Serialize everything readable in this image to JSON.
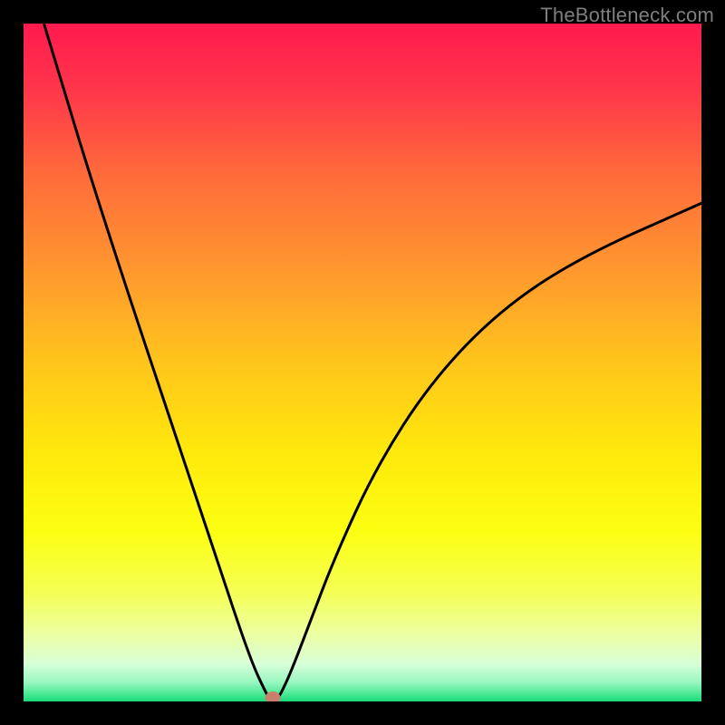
{
  "watermark": "TheBottleneck.com",
  "chart_data": {
    "type": "line",
    "title": "",
    "xlabel": "",
    "ylabel": "",
    "xlim": [
      0,
      100
    ],
    "ylim": [
      0,
      100
    ],
    "grid": false,
    "legend": false,
    "gradient_stops": [
      {
        "offset": 0.0,
        "color": "#ff1a4e"
      },
      {
        "offset": 0.1,
        "color": "#ff374a"
      },
      {
        "offset": 0.22,
        "color": "#ff6a3b"
      },
      {
        "offset": 0.35,
        "color": "#ff9330"
      },
      {
        "offset": 0.5,
        "color": "#ffc51c"
      },
      {
        "offset": 0.63,
        "color": "#ffe80c"
      },
      {
        "offset": 0.75,
        "color": "#fcff12"
      },
      {
        "offset": 0.84,
        "color": "#f4ff55"
      },
      {
        "offset": 0.9,
        "color": "#edffa2"
      },
      {
        "offset": 0.945,
        "color": "#d8ffd8"
      },
      {
        "offset": 0.972,
        "color": "#98f7c0"
      },
      {
        "offset": 0.99,
        "color": "#45e890"
      },
      {
        "offset": 1.0,
        "color": "#1bd97a"
      }
    ],
    "series": [
      {
        "name": "bottleneck-curve",
        "color": "#000000",
        "stroke_width": 3,
        "x": [
          3.0,
          6.0,
          10.0,
          15.0,
          20.0,
          25.0,
          29.0,
          32.0,
          34.0,
          35.5,
          36.3,
          37.3,
          38.0,
          39.5,
          42.0,
          46.0,
          52.0,
          60.0,
          70.0,
          82.0,
          100.0
        ],
        "values": [
          100.0,
          90.0,
          77.0,
          61.5,
          46.5,
          31.5,
          19.5,
          10.5,
          5.0,
          1.8,
          0.3,
          0.3,
          1.2,
          4.5,
          11.0,
          21.5,
          34.5,
          47.0,
          57.5,
          65.5,
          73.5
        ]
      }
    ],
    "marker": {
      "x": 36.8,
      "y": 0.5,
      "color": "#c97f6c"
    }
  }
}
